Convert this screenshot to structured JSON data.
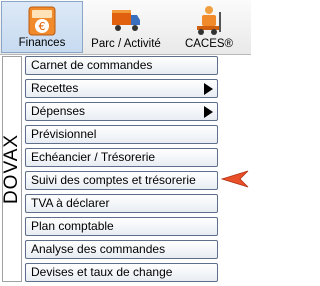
{
  "toolbar": {
    "tabs": [
      {
        "label": "Finances",
        "icon": "calculator-euro-icon"
      },
      {
        "label": "Parc / Activité",
        "icon": "truck-icon"
      },
      {
        "label": "CACES®",
        "icon": "forklift-icon"
      }
    ],
    "selected": "Finances"
  },
  "sidebar": {
    "title": "DOVAX"
  },
  "menu": {
    "items": [
      {
        "label": "Carnet de commandes"
      },
      {
        "label": "Recettes",
        "submenu": true
      },
      {
        "label": "Dépenses",
        "submenu": true
      },
      {
        "label": "Prévisionnel"
      },
      {
        "label": "Echéancier / Trésorerie"
      },
      {
        "label": "Suivi des comptes et trésorerie",
        "pointed": true
      },
      {
        "label": "TVA à déclarer"
      },
      {
        "label": "Plan comptable"
      },
      {
        "label": "Analyse des commandes"
      },
      {
        "label": "Devises et taux de change"
      }
    ]
  },
  "colors": {
    "pointer": "#e8502a",
    "selected_tab": "#c7daf0",
    "button_border": "#5d6f8a"
  }
}
